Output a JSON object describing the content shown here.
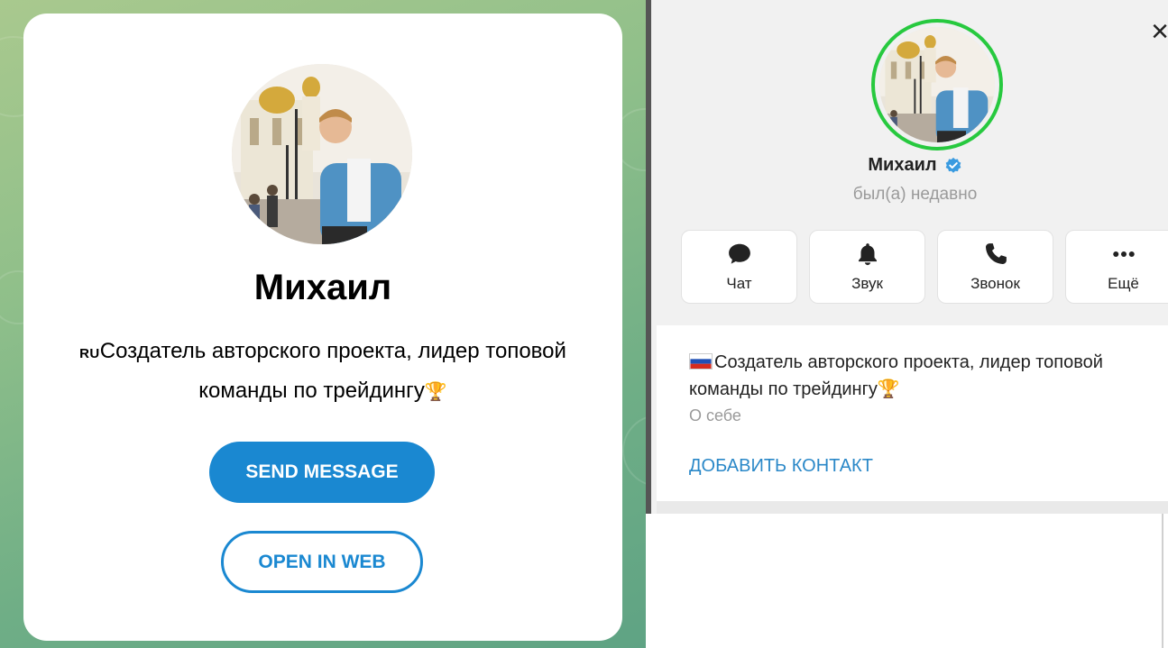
{
  "left_card": {
    "name": "Михаил",
    "bio_prefix": "RU",
    "bio_line1": "Создатель авторского проекта, лидер топовой",
    "bio_line2": "команды по трейдингу",
    "trophy": "🏆",
    "send_message_label": "SEND MESSAGE",
    "open_in_web_label": "OPEN IN WEB"
  },
  "right_profile": {
    "close_glyph": "×",
    "name": "Михаил",
    "status": "был(а) недавно",
    "actions": [
      {
        "label": "Чат",
        "icon": "chat-icon"
      },
      {
        "label": "Звук",
        "icon": "bell-icon"
      },
      {
        "label": "Звонок",
        "icon": "phone-icon"
      },
      {
        "label": "Ещё",
        "icon": "more-icon"
      }
    ],
    "bio_line1": "Создатель авторского проекта, лидер топовой",
    "bio_line2": "команды по трейдингу",
    "trophy": "🏆",
    "bio_caption": "О себе",
    "add_contact_label": "ДОБАВИТЬ КОНТАКТ"
  },
  "colors": {
    "accent": "#1a88d1",
    "online_ring": "#27c93f",
    "verified": "#3a9be0",
    "link": "#2a88c8"
  }
}
